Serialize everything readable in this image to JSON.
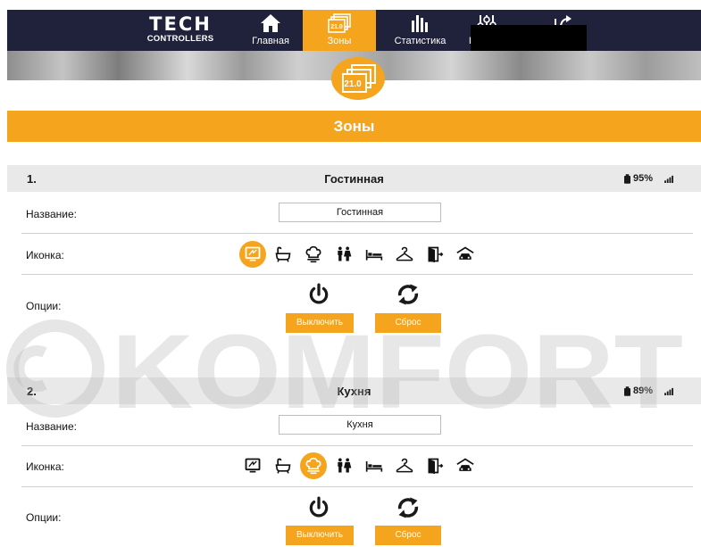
{
  "colors": {
    "accent": "#f5a41e",
    "nav_bg": "#20213a",
    "section_bg": "#e9e9e9"
  },
  "nav": {
    "logo": {
      "line1": "TECH",
      "line2": "CONTROLLERS"
    },
    "items": [
      {
        "label": "Главная",
        "icon": "home-icon",
        "active": false
      },
      {
        "label": "Зоны",
        "icon": "zones-icon",
        "active": true,
        "icon_text": "21.0"
      },
      {
        "label": "Статистика",
        "icon": "statistics-icon",
        "active": false
      },
      {
        "label": "На",
        "icon": "settings-sliders-icon",
        "active": false
      },
      {
        "label": "",
        "icon": "exit-icon",
        "active": false
      }
    ]
  },
  "header": {
    "badge_text": "21.0",
    "title": "Зоны"
  },
  "zones": [
    {
      "index": "1.",
      "name": "Гостинная",
      "battery": "95%",
      "name_label": "Название:",
      "name_value": "Гостинная",
      "icon_label": "Иконка:",
      "selected_icon": 0,
      "options_label": "Опции:",
      "off_button": "Выключить",
      "reset_button": "Сброс"
    },
    {
      "index": "2.",
      "name": "Кухня",
      "battery": "89%",
      "name_label": "Название:",
      "name_value": "Кухня",
      "icon_label": "Иконка:",
      "selected_icon": 2,
      "options_label": "Опции:",
      "off_button": "Выключить",
      "reset_button": "Сброс"
    }
  ],
  "room_icons": [
    "tv-icon",
    "bathtub-icon",
    "chef-hat-icon",
    "children-icon",
    "bed-icon",
    "hanger-icon",
    "door-icon",
    "car-icon"
  ],
  "watermark": "KOMFORT"
}
